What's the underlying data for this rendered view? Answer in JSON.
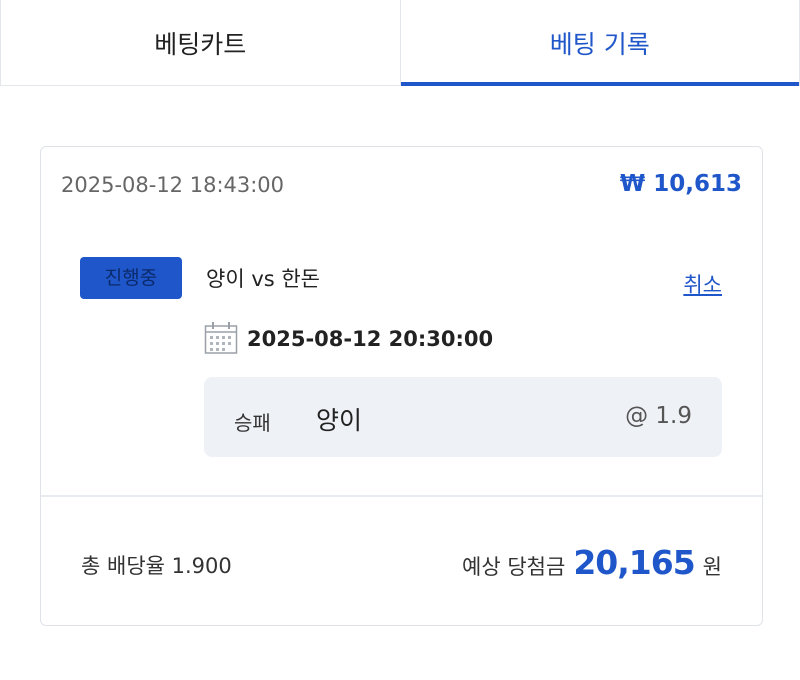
{
  "tabs": [
    {
      "label": "베팅카트",
      "active": false
    },
    {
      "label": "베팅 기록",
      "active": true
    }
  ],
  "bet": {
    "placed_at": "2025-08-12 18:43:00",
    "stake": "₩ 10,613",
    "status": "진행중",
    "match": "양이 vs 한돈",
    "cancel_label": "취소",
    "match_datetime": "2025-08-12 20:30:00",
    "pick": {
      "market": "승패",
      "selection": "양이",
      "odds": "@ 1.9"
    },
    "total_odds_label": "총 배당율 1.900",
    "payout_label": "예상 당첨금",
    "payout_amount": "20,165",
    "payout_unit": "원"
  },
  "colors": {
    "accent": "#1f56c9",
    "pick_bg": "#eef1f6",
    "border": "#dfe3e8"
  },
  "icons": {
    "calendar": "calendar-icon"
  }
}
